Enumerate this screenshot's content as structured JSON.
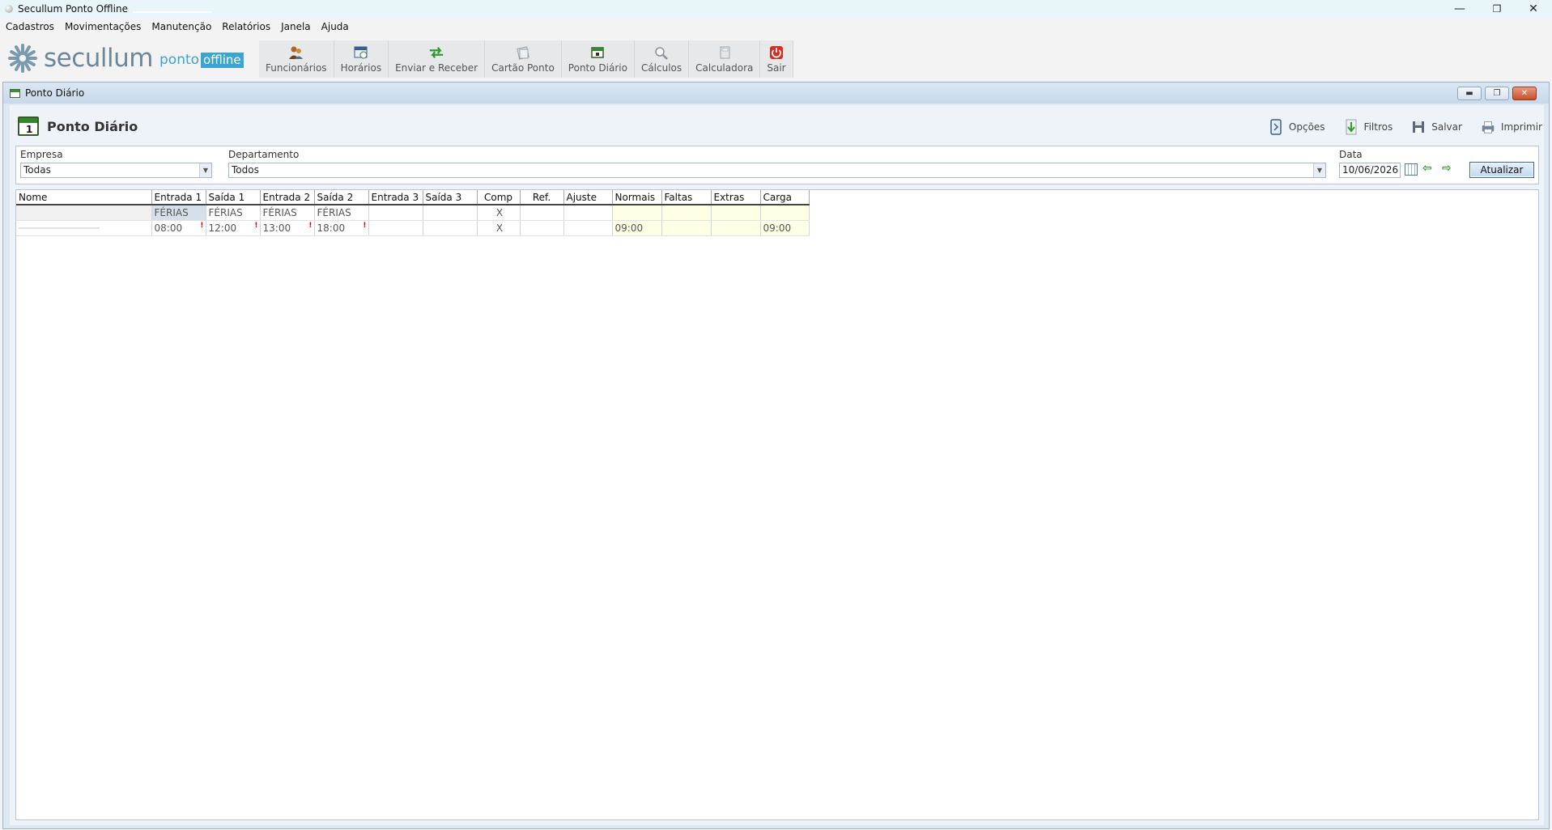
{
  "window": {
    "title": "Secullum Ponto Offline",
    "controls": {
      "minimize": "—",
      "maximize": "❐",
      "close": "✕"
    }
  },
  "menu": [
    "Cadastros",
    "Movimentações",
    "Manutenção",
    "Relatórios",
    "Janela",
    "Ajuda"
  ],
  "logo": {
    "word": "secullum",
    "ponto": "ponto",
    "offline": "offline"
  },
  "toolbar": [
    {
      "label": "Funcionários",
      "icon": "employees-icon"
    },
    {
      "label": "Horários",
      "icon": "schedule-icon"
    },
    {
      "label": "Enviar e Receber",
      "icon": "send-receive-icon"
    },
    {
      "label": "Cartão Ponto",
      "icon": "timecard-icon"
    },
    {
      "label": "Ponto Diário",
      "icon": "calendar-icon"
    },
    {
      "label": "Cálculos",
      "icon": "calculations-icon"
    },
    {
      "label": "Calculadora",
      "icon": "calculator-icon"
    },
    {
      "label": "Sair",
      "icon": "power-icon"
    }
  ],
  "mdi": {
    "title": "Ponto Diário",
    "heading": "Ponto Diário",
    "calendar_day": "1",
    "actions": [
      {
        "label": "Opções",
        "icon": "options-icon"
      },
      {
        "label": "Filtros",
        "icon": "filter-icon"
      },
      {
        "label": "Salvar",
        "icon": "save-icon"
      },
      {
        "label": "Imprimir",
        "icon": "print-icon"
      }
    ]
  },
  "filters": {
    "empresa_label": "Empresa",
    "empresa_value": "Todas",
    "departamento_label": "Departamento",
    "departamento_value": "Todos",
    "data_label": "Data",
    "data_value": "10/06/2026",
    "atualizar": "Atualizar"
  },
  "grid": {
    "columns": [
      "Nome",
      "Entrada 1",
      "Saída 1",
      "Entrada 2",
      "Saída 2",
      "Entrada 3",
      "Saída 3",
      "Comp",
      "Ref.",
      "Ajuste",
      "Normais",
      "Faltas",
      "Extras",
      "Carga"
    ],
    "rows": [
      {
        "nome": "",
        "e1": "FÉRIAS",
        "s1": "FÉRIAS",
        "e2": "FÉRIAS",
        "s2": "FÉRIAS",
        "e3": "",
        "s3": "",
        "comp": "X",
        "ref": "",
        "ajuste": "",
        "normais": "",
        "faltas": "",
        "extras": "",
        "carga": ""
      },
      {
        "nome": "",
        "e1": "08:00",
        "s1": "12:00",
        "e2": "13:00",
        "s2": "18:00",
        "e3": "",
        "s3": "",
        "comp": "X",
        "ref": "",
        "ajuste": "",
        "normais": "09:00",
        "faltas": "",
        "extras": "",
        "carga": "09:00",
        "mark": "!"
      }
    ]
  },
  "colors": {
    "accent": "#3aa4d4",
    "ferias": "#1a1adb",
    "alert": "#e00000"
  }
}
